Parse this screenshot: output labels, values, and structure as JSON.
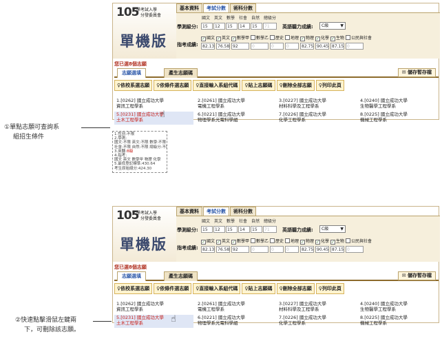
{
  "header": {
    "year": "105",
    "org_line1": "大學考試入學",
    "org_line2": "分發委員會",
    "edition": "單機版",
    "tabs": [
      "基本資料",
      "考試分數",
      "術科分數"
    ],
    "active_tab": 1
  },
  "scores": {
    "xuece_label": "學測級分:",
    "subjects": [
      "國文",
      "英文",
      "數學",
      "社會",
      "自然",
      "總級分"
    ],
    "values": [
      "15",
      "12",
      "15",
      "14",
      "15",
      "71"
    ],
    "english_label": "英語聽力成績:",
    "english_value": "C級",
    "zhike_label": "指考成績:",
    "zhike_subjects": [
      "國文",
      "英文",
      "數學甲",
      "數學乙",
      "歷史",
      "地理",
      "物理",
      "化學",
      "生物",
      "公民與社會"
    ],
    "zhike_checked": [
      true,
      true,
      true,
      false,
      false,
      false,
      true,
      true,
      true,
      false
    ],
    "zhike_values": [
      "82.13",
      "76.58",
      "92",
      "0",
      "0",
      "0",
      "82.75",
      "90.45",
      "87.15",
      "0"
    ]
  },
  "status": {
    "count_text": "您已選8個志願",
    "tab_list": "志願選填",
    "tab_generate": "產生志願碼",
    "save_button": "✉ 儲存暫存檔"
  },
  "actions": [
    "♀依校系選志願",
    "♀依條件選志願",
    "♀直接輸入系組代碼",
    "♀貼上志願碼",
    "♀刪除全部志願",
    "♀列印此頁"
  ],
  "choices": [
    {
      "no": "1.",
      "code": "[0262]",
      "school": "國立成功大學",
      "dept": "資訊工程學系"
    },
    {
      "no": "2.",
      "code": "[0261]",
      "school": "國立成功大學",
      "dept": "電機工程學系"
    },
    {
      "no": "3.",
      "code": "[0227]",
      "school": "國立成功大學",
      "dept": "材料科學及工程學系"
    },
    {
      "no": "4.",
      "code": "[0240]",
      "school": "國立成功大學",
      "dept": "生物醫學工程學系"
    },
    {
      "no": "5.",
      "code": "[0231]",
      "school": "國立成功大學",
      "dept": "土木工程學系"
    },
    {
      "no": "6.",
      "code": "[0221]",
      "school": "國立成功大學",
      "dept": "物理學系光電科學組"
    },
    {
      "no": "7.",
      "code": "[0226]",
      "school": "國立成功大學",
      "dept": "化學工程學系"
    },
    {
      "no": "8.",
      "code": "[0225]",
      "school": "國立成功大學",
      "dept": "機械工程學系"
    }
  ],
  "tooltip": {
    "lines": [
      "1.性別:不限",
      "2.學測:",
      "  國文:不限 英文:不限 數學:不限",
      "  社會:不限 自然:不限 總級分:不限",
      "3.英聽:",
      "4.指考:",
      "  國文 英文 數學甲 物理 化學",
      "5.最低登記標準:430.64",
      "  考生原始總分:424.30"
    ],
    "english_level": "B級"
  },
  "callouts": {
    "one_a": "①單點志願可查詢系",
    "one_b": "組招生條件",
    "two_a": "②快速點擊滑鼠左鍵兩",
    "two_b": "下，可刪除該志願。"
  },
  "colors": {
    "accent": "#2a56a8",
    "highlight": "#c8201a",
    "panel_border": "#c9b48a",
    "bg_panel": "#f6efdc"
  }
}
